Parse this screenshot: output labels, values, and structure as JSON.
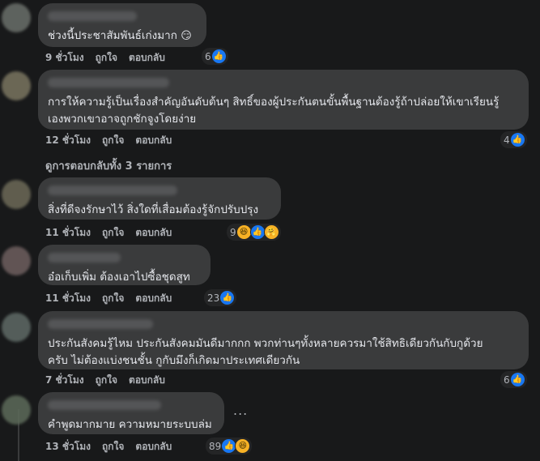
{
  "comments": [
    {
      "text": "ช่วงนี้ประชาสัมพันธ์เก่งมาก",
      "emoji": "😏",
      "time": "9 ชั่วโมง",
      "like": "ถูกใจ",
      "reply": "ตอบกลับ",
      "reaction_count": "6",
      "reactions": [
        "like-icon"
      ]
    },
    {
      "text": "การให้ความรู้เป็นเรื่องสำคัญอันดับต้นๆ สิทธิ์ของผู้ประกันตนขั้นพื้นฐานต้องรู้ถ้าปล่อยให้เขาเรียนรู้\nเองพวกเขาอาจถูกชักจูงโดยง่าย",
      "time": "12 ชั่วโมง",
      "like": "ถูกใจ",
      "reply": "ตอบกลับ",
      "reaction_count": "4",
      "reactions": [
        "like-icon"
      ],
      "replies_link": "ดูการตอบกลับทั้ง 3 รายการ"
    },
    {
      "text": "สิ่งที่ดีจงรักษาไว้ สิ่งใดที่เสื่อมต้องรู้จักปรับปรุง",
      "time": "11 ชั่วโมง",
      "like": "ถูกใจ",
      "reply": "ตอบกลับ",
      "reaction_count": "9",
      "reactions": [
        "haha-icon",
        "like-icon",
        "care-icon"
      ]
    },
    {
      "text": "อ๋อเก็บเพิ่ม ต้องเอาไปซื้อชุดสูท",
      "time": "11 ชั่วโมง",
      "like": "ถูกใจ",
      "reply": "ตอบกลับ",
      "reaction_count": "23",
      "reactions": [
        "like-icon"
      ]
    },
    {
      "text": "ประกันสังคมรู้ไหม ประกันสังคมมันดีมากกก พวกท่านๆทั้งหลายควรมาใช้สิทธิเดียวกันกับกูด้วย\nครับ ไม่ต้องแบ่งชนชั้น กูกับมึงก็เกิดมาประเทศเดียวกัน",
      "time": "7 ชั่วโมง",
      "like": "ถูกใจ",
      "reply": "ตอบกลับ",
      "reaction_count": "6",
      "reactions": [
        "like-icon"
      ]
    },
    {
      "text": "คำพูดมากมาย ความหมายระบบล่ม",
      "time": "13 ชั่วโมง",
      "like": "ถูกใจ",
      "reply": "ตอบกลับ",
      "reaction_count": "89",
      "reactions": [
        "like-icon",
        "haha-icon"
      ],
      "more": "..."
    }
  ],
  "colors": {
    "background": "#18191a",
    "bubble": "#3a3b3c",
    "meta": "#b0b3b8",
    "like": "#1877f2"
  }
}
